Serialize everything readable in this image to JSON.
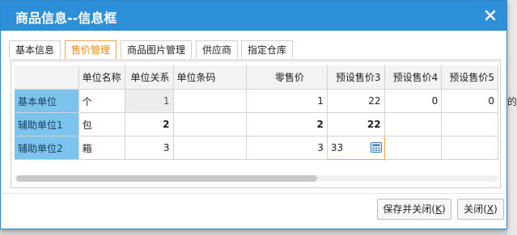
{
  "dialog": {
    "title": "商品信息--信息框"
  },
  "tabs": [
    {
      "label": "基本信息",
      "active": false
    },
    {
      "label": "售价管理",
      "active": true
    },
    {
      "label": "商品图片管理",
      "active": false
    },
    {
      "label": "供应商",
      "active": false
    },
    {
      "label": "指定仓库",
      "active": false
    }
  ],
  "grid": {
    "columns": [
      "",
      "单位名称",
      "单位关系",
      "单位条码",
      "零售价",
      "预设售价3",
      "预设售价4",
      "预设售价5"
    ],
    "rows": [
      {
        "label": "基本单位",
        "unit": "个",
        "relation": "1",
        "barcode": "",
        "retail": "1",
        "p3": "22",
        "p4": "0",
        "p5": "0"
      },
      {
        "label": "辅助单位1",
        "unit": "包",
        "relation": "2",
        "barcode": "",
        "retail": "2",
        "p3": "22",
        "p4": "",
        "p5": ""
      },
      {
        "label": "辅助单位2",
        "unit": "箱",
        "relation": "3",
        "barcode": "",
        "retail": "3",
        "p3": "33",
        "p4": "",
        "p5": ""
      }
    ]
  },
  "buttons": {
    "save_close": "保存并关闭(",
    "save_close_key": "K",
    "save_close_end": ")",
    "close": "关闭(",
    "close_key": "X",
    "close_end": ")"
  },
  "background": {
    "fragment": "的"
  }
}
